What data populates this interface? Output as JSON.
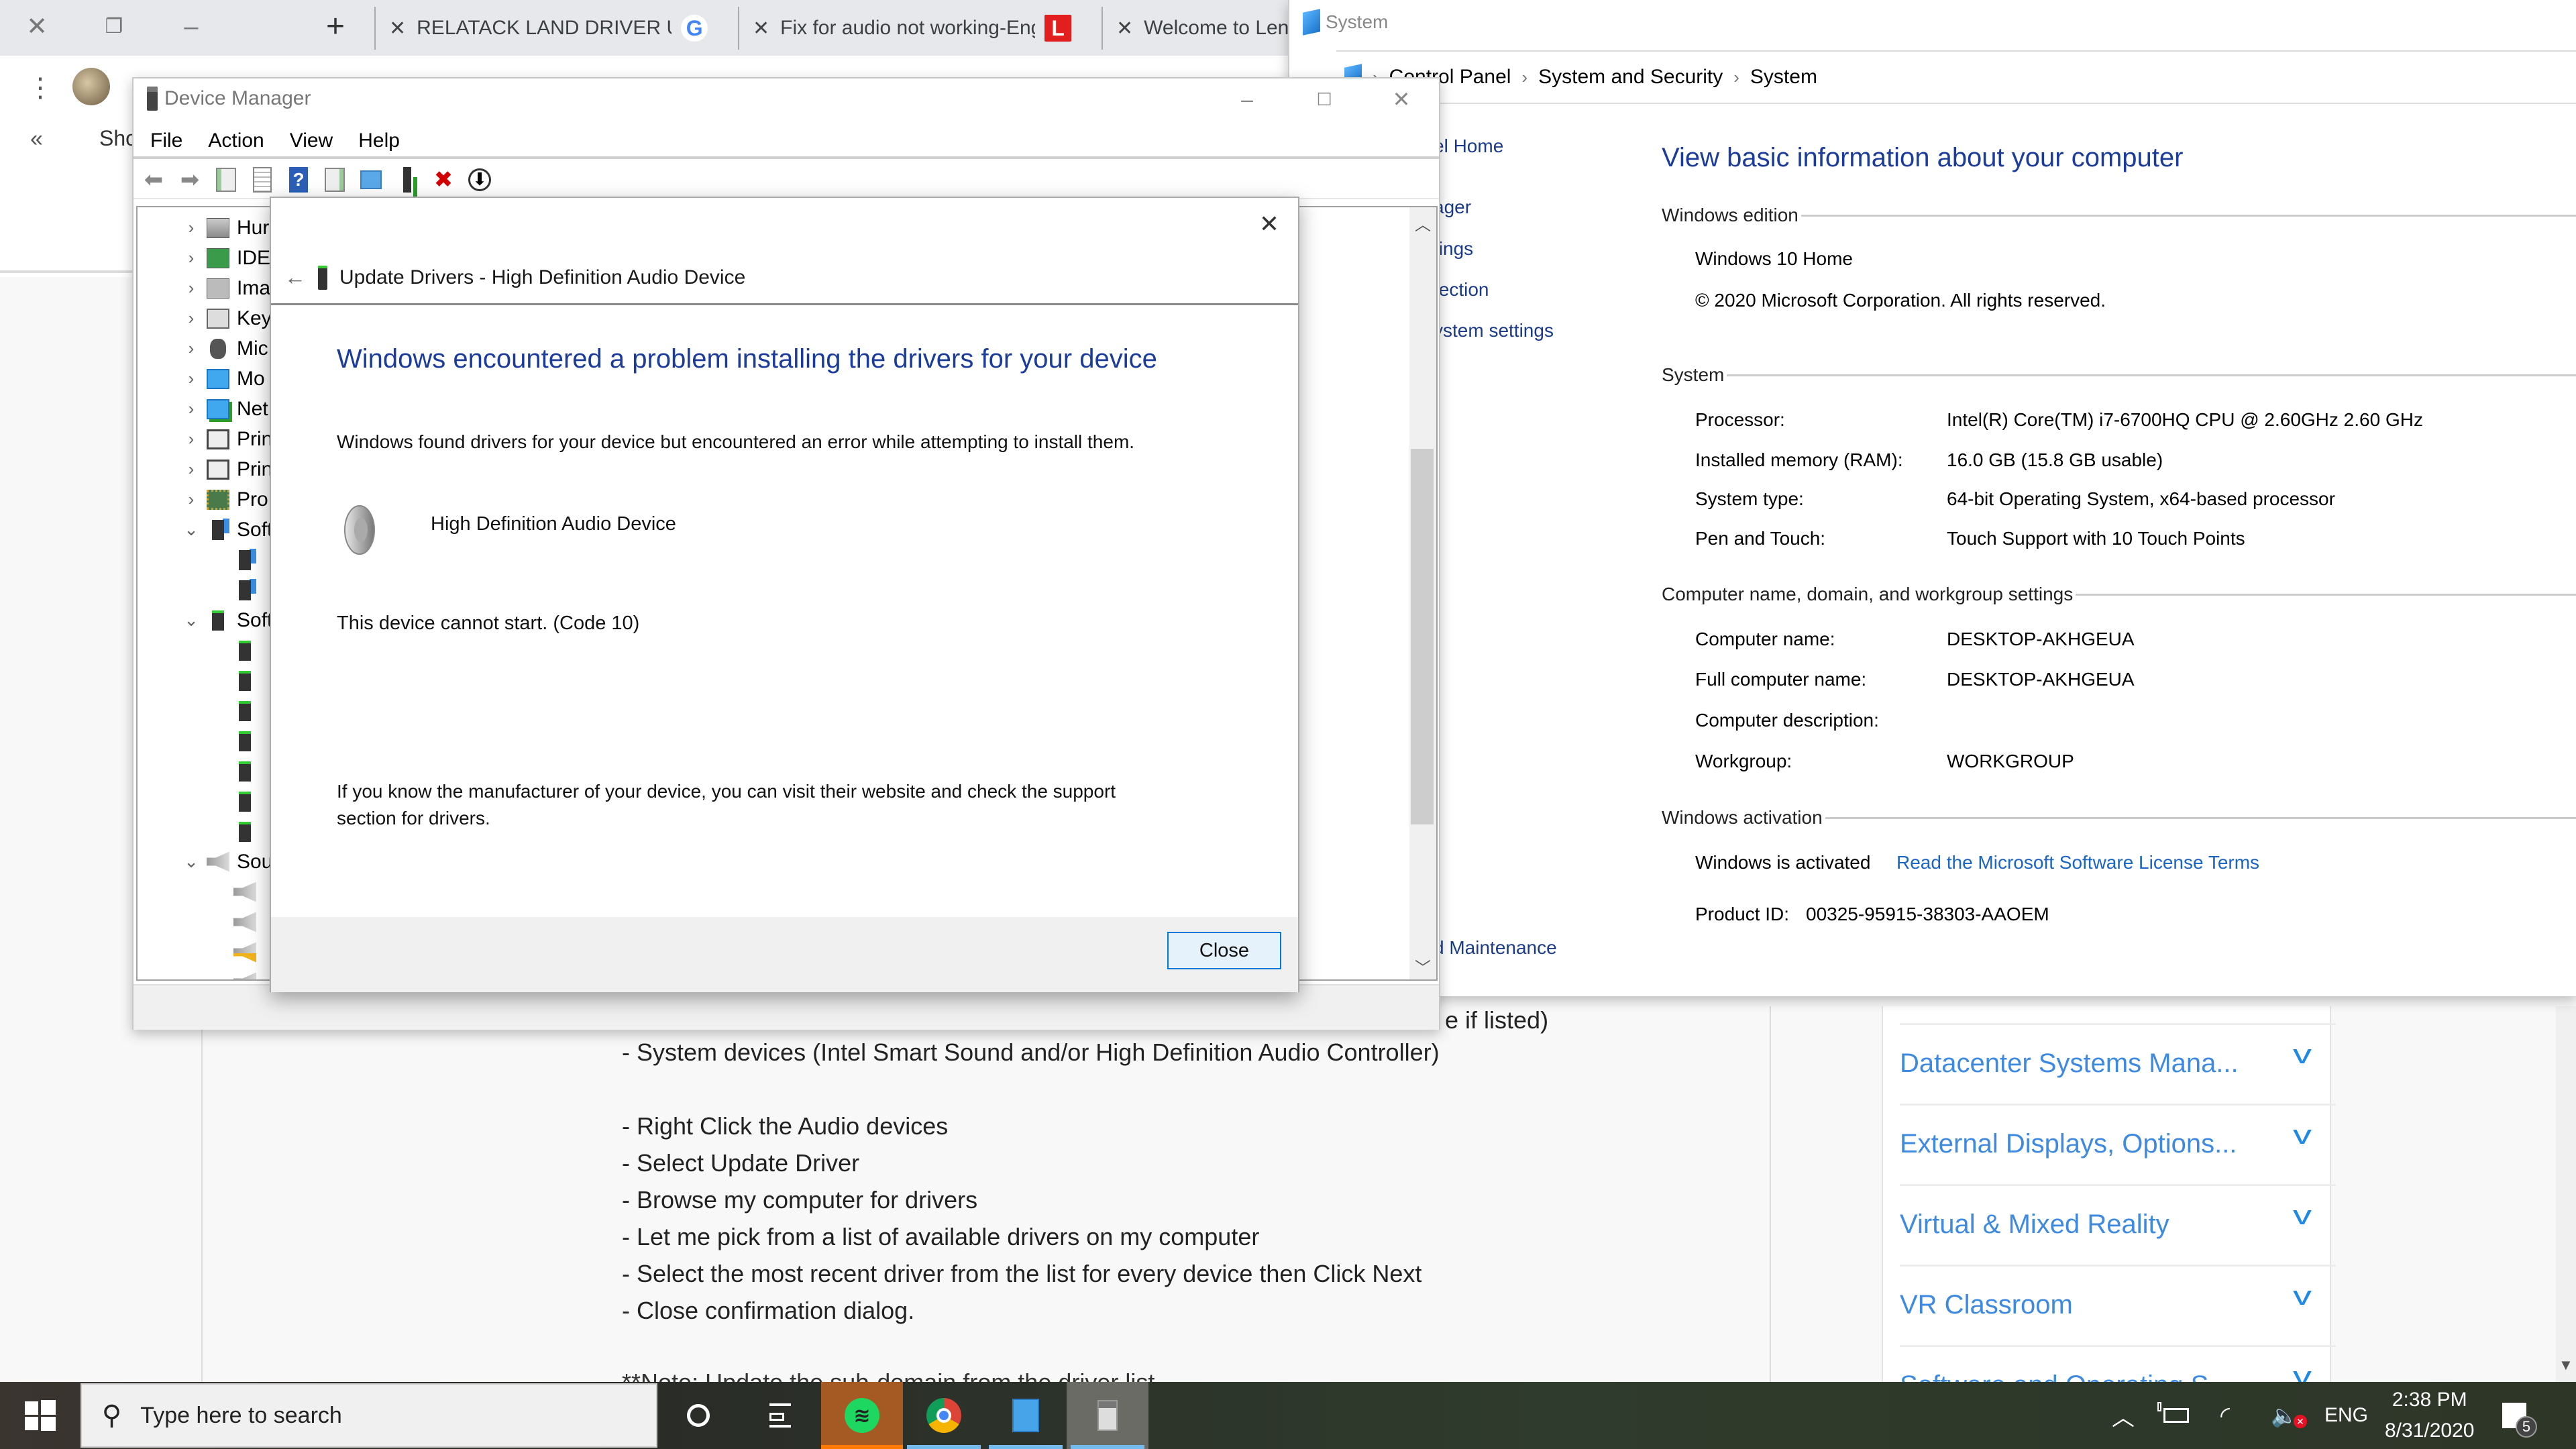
{
  "browser": {
    "tabs": [
      {
        "title": "RELATACK LAND DRIVER UPD",
        "favicon": "G",
        "favicon_color": "#4285f4"
      },
      {
        "title": "Fix for audio not working-Eng",
        "favicon": "L",
        "favicon_color": "#e21e1e"
      },
      {
        "title": "Welcome to Len",
        "favicon": "",
        "favicon_color": ""
      }
    ],
    "new_tab": "+",
    "sidebar_collapse": "«",
    "sidebar_show": "Sho",
    "page": {
      "partial_line": "e if listed)",
      "lines": [
        "- System devices (Intel Smart Sound and/or High Definition Audio Controller)",
        "- Right Click the Audio devices",
        "- Select Update Driver",
        "- Browse my computer for drivers",
        "- Let me pick from a list of available drivers on my computer",
        "- Select the most recent driver from the list for every device then Click Next",
        "- Close confirmation dialog."
      ],
      "cutoff_line": "**Note: Update the sub-domain from the driver list..."
    },
    "right_rail": [
      {
        "label": "Datacenter Systems Mana..."
      },
      {
        "label": "External Displays, Options..."
      },
      {
        "label": "Virtual & Mixed Reality"
      },
      {
        "label": "VR Classroom"
      },
      {
        "label": "Software and Operating S"
      }
    ]
  },
  "system_window": {
    "title": "System",
    "breadcrumb": [
      "Control Panel",
      "System and Security",
      "System"
    ],
    "side_links": [
      "el Home",
      "ager",
      "tings",
      "tection",
      "ystem settings",
      "d Maintenance"
    ],
    "heading": "View basic information about your computer",
    "sections": {
      "edition": {
        "title": "Windows edition",
        "name": "Windows 10 Home",
        "copyright": "© 2020 Microsoft Corporation. All rights reserved."
      },
      "system": {
        "title": "System",
        "rows": [
          {
            "label": "Processor:",
            "value": "Intel(R) Core(TM) i7-6700HQ CPU @ 2.60GHz   2.60 GHz"
          },
          {
            "label": "Installed memory (RAM):",
            "value": "16.0 GB (15.8 GB usable)"
          },
          {
            "label": "System type:",
            "value": "64-bit Operating System, x64-based processor"
          },
          {
            "label": "Pen and Touch:",
            "value": "Touch Support with 10 Touch Points"
          }
        ]
      },
      "computer": {
        "title": "Computer name, domain, and workgroup settings",
        "rows": [
          {
            "label": "Computer name:",
            "value": "DESKTOP-AKHGEUA"
          },
          {
            "label": "Full computer name:",
            "value": "DESKTOP-AKHGEUA"
          },
          {
            "label": "Computer description:",
            "value": ""
          },
          {
            "label": "Workgroup:",
            "value": "WORKGROUP"
          }
        ]
      },
      "activation": {
        "title": "Windows activation",
        "status": "Windows is activated",
        "license_link": "Read the Microsoft Software License Terms",
        "product_id_label": "Product ID:",
        "product_id": "00325-95915-38303-AAOEM"
      }
    }
  },
  "device_manager": {
    "title": "Device Manager",
    "menu": [
      "File",
      "Action",
      "View",
      "Help"
    ],
    "tree": [
      {
        "label": "Hur",
        "caret": ">",
        "icon": "hid-icon"
      },
      {
        "label": "IDE",
        "caret": ">",
        "icon": "ide-icon"
      },
      {
        "label": "Ima",
        "caret": ">",
        "icon": "imaging-icon"
      },
      {
        "label": "Key",
        "caret": ">",
        "icon": "keyboard-icon"
      },
      {
        "label": "Mic",
        "caret": ">",
        "icon": "mouse-icon"
      },
      {
        "label": "Mo",
        "caret": ">",
        "icon": "monitor-icon"
      },
      {
        "label": "Net",
        "caret": ">",
        "icon": "network-icon"
      },
      {
        "label": "Prin",
        "caret": ">",
        "icon": "printer-icon"
      },
      {
        "label": "Prin",
        "caret": ">",
        "icon": "printer-icon"
      },
      {
        "label": "Pro",
        "caret": ">",
        "icon": "processor-icon"
      },
      {
        "label": "Soft",
        "caret": "v",
        "icon": "software-component-icon"
      },
      {
        "label": "",
        "caret": "",
        "icon": "software-component-icon",
        "child": true
      },
      {
        "label": "",
        "caret": "",
        "icon": "software-component-icon",
        "child": true
      },
      {
        "label": "Soft",
        "caret": "v",
        "icon": "software-device-icon"
      },
      {
        "label": "",
        "caret": "",
        "icon": "software-device-icon",
        "child": true
      },
      {
        "label": "",
        "caret": "",
        "icon": "software-device-icon",
        "child": true
      },
      {
        "label": "",
        "caret": "",
        "icon": "software-device-icon",
        "child": true
      },
      {
        "label": "",
        "caret": "",
        "icon": "software-device-icon",
        "child": true
      },
      {
        "label": "",
        "caret": "",
        "icon": "software-device-icon",
        "child": true
      },
      {
        "label": "",
        "caret": "",
        "icon": "software-device-icon",
        "child": true
      },
      {
        "label": "",
        "caret": "",
        "icon": "software-device-icon",
        "child": true
      },
      {
        "label": "Sou",
        "caret": "v",
        "icon": "speaker-icon"
      },
      {
        "label": "",
        "caret": "",
        "icon": "speaker-icon",
        "child": true
      },
      {
        "label": "",
        "caret": "",
        "icon": "speaker-icon",
        "child": true
      },
      {
        "label": "",
        "caret": "",
        "icon": "speaker-warning-icon",
        "child": true
      },
      {
        "label": "",
        "caret": "",
        "icon": "speaker-icon",
        "child": true
      }
    ]
  },
  "update_dialog": {
    "header_title": "Update Drivers - High Definition Audio Device",
    "heading": "Windows encountered a problem installing the drivers for your device",
    "message": "Windows found drivers for your device but encountered an error while attempting to install them.",
    "device_name": "High Definition Audio Device",
    "error": "This device cannot start. (Code 10)",
    "help_text": "If you know the manufacturer of your device, you can visit their website and check the support section for drivers.",
    "close_label": "Close"
  },
  "taskbar": {
    "search_placeholder": "Type here to search",
    "language": "ENG",
    "time": "2:38 PM",
    "date": "8/31/2020",
    "notification_count": "5"
  }
}
